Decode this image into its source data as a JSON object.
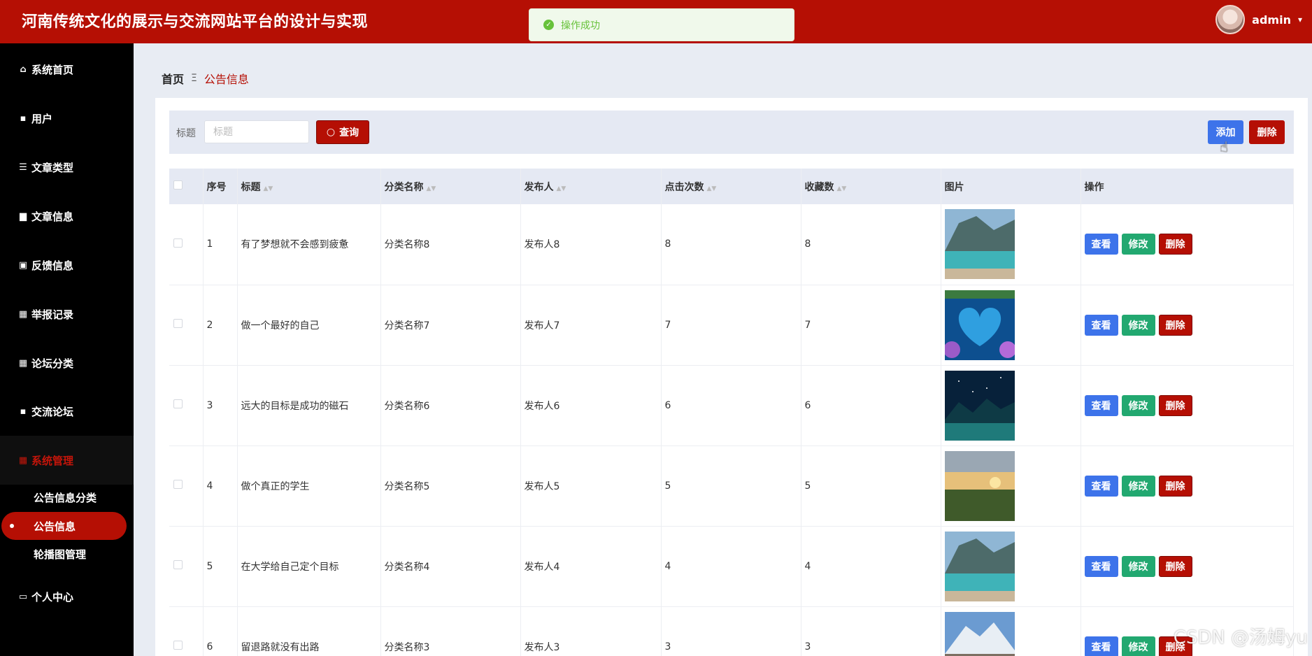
{
  "header": {
    "title": "河南传统文化的展示与交流网站平台的设计与实现",
    "user_name": "admin",
    "caret": "▾",
    "bg_color": "#b50f04"
  },
  "toast": {
    "message": "操作成功",
    "icon": "check-circle-icon"
  },
  "sidebar": {
    "items": [
      {
        "label": "系统首页",
        "icon": "home-icon"
      },
      {
        "label": "用户",
        "icon": "comment-icon"
      },
      {
        "label": "文章类型",
        "icon": "list-icon"
      },
      {
        "label": "文章信息",
        "icon": "briefcase-icon"
      },
      {
        "label": "反馈信息",
        "icon": "clipboard-icon"
      },
      {
        "label": "举报记录",
        "icon": "grid-icon"
      },
      {
        "label": "论坛分类",
        "icon": "grid-icon"
      },
      {
        "label": "交流论坛",
        "icon": "chat-icon"
      },
      {
        "label": "系统管理",
        "icon": "grid-icon"
      },
      {
        "label": "个人中心",
        "icon": "calendar-icon"
      }
    ],
    "sub_items": [
      {
        "label": "公告信息分类"
      },
      {
        "label": "公告信息"
      },
      {
        "label": "轮播图管理"
      }
    ]
  },
  "breadcrumb": {
    "home": "首页",
    "separator": "Ξ",
    "current": "公告信息"
  },
  "search": {
    "label": "标题",
    "placeholder": "标题",
    "query_button": "查询",
    "add_button": "添加",
    "delete_button": "删除"
  },
  "table": {
    "headers": {
      "index": "序号",
      "title": "标题",
      "category": "分类名称",
      "publisher": "发布人",
      "clicks": "点击次数",
      "favorites": "收藏数",
      "image": "图片",
      "actions": "操作"
    },
    "action_labels": {
      "view": "查看",
      "edit": "修改",
      "delete": "删除"
    },
    "rows": [
      {
        "index": "1",
        "title": "有了梦想就不会感到疲惫",
        "category": "分类名称8",
        "publisher": "发布人8",
        "clicks": "8",
        "favorites": "8",
        "image": "lake-mountain"
      },
      {
        "index": "2",
        "title": "做一个最好的自己",
        "category": "分类名称7",
        "publisher": "发布人7",
        "clicks": "7",
        "favorites": "7",
        "image": "heart-lake"
      },
      {
        "index": "3",
        "title": "远大的目标是成功的磁石",
        "category": "分类名称6",
        "publisher": "发布人6",
        "clicks": "6",
        "favorites": "6",
        "image": "starry-lake"
      },
      {
        "index": "4",
        "title": "做个真正的学生",
        "category": "分类名称5",
        "publisher": "发布人5",
        "clicks": "5",
        "favorites": "5",
        "image": "sunset-field"
      },
      {
        "index": "5",
        "title": "在大学给自己定个目标",
        "category": "分类名称4",
        "publisher": "发布人4",
        "clicks": "4",
        "favorites": "4",
        "image": "lake-mountain"
      },
      {
        "index": "6",
        "title": "留退路就没有出路",
        "category": "分类名称3",
        "publisher": "发布人3",
        "clicks": "3",
        "favorites": "3",
        "image": "snow-mountain"
      }
    ]
  },
  "watermark": "CSDN @汤姆yu"
}
